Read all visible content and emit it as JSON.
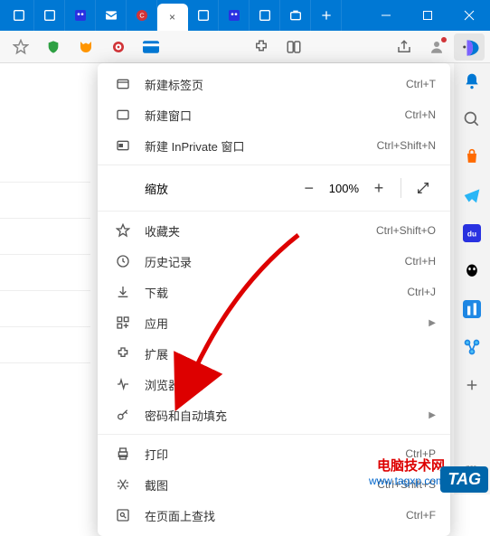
{
  "titlebar": {
    "active_tab": "×"
  },
  "menu": {
    "new_tab": {
      "label": "新建标签页",
      "shortcut": "Ctrl+T"
    },
    "new_window": {
      "label": "新建窗口",
      "shortcut": "Ctrl+N"
    },
    "new_inprivate": {
      "label": "新建 InPrivate 窗口",
      "shortcut": "Ctrl+Shift+N"
    },
    "zoom": {
      "label": "缩放",
      "value": "100%"
    },
    "favorites": {
      "label": "收藏夹",
      "shortcut": "Ctrl+Shift+O"
    },
    "history": {
      "label": "历史记录",
      "shortcut": "Ctrl+H"
    },
    "downloads": {
      "label": "下载",
      "shortcut": "Ctrl+J"
    },
    "apps": {
      "label": "应用"
    },
    "extensions": {
      "label": "扩展"
    },
    "browser_essentials": {
      "label": "浏览器概要"
    },
    "passwords": {
      "label": "密码和自动填充"
    },
    "print": {
      "label": "打印",
      "shortcut": "Ctrl+P"
    },
    "screenshot": {
      "label": "截图",
      "shortcut": "Ctrl+Shift+S"
    },
    "find": {
      "label": "在页面上查找",
      "shortcut": "Ctrl+F"
    }
  },
  "watermark": {
    "line1": "电脑技术网",
    "line2": "www.tagxp.com",
    "badge": "TAG"
  }
}
